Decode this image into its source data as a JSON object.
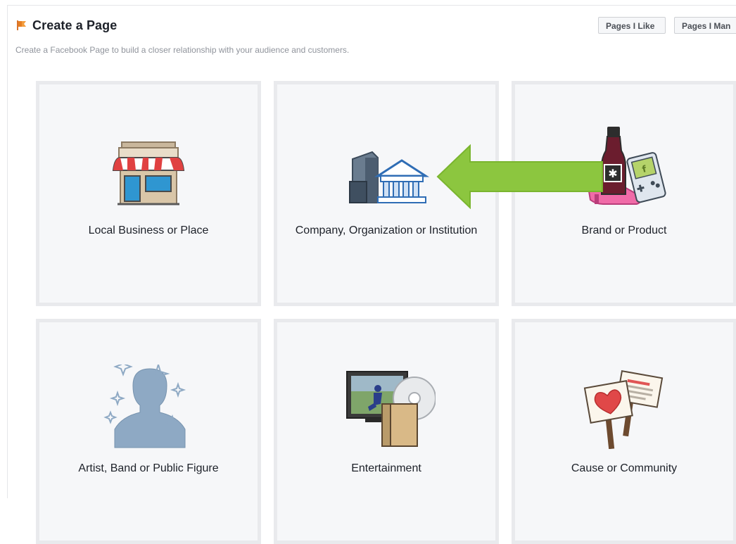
{
  "header": {
    "title": "Create a Page",
    "subtitle": "Create a Facebook Page to build a closer relationship with your audience and customers.",
    "buttons": {
      "pages_i_like": "Pages I Like",
      "pages_i_manage": "Pages I Man"
    },
    "icon": "flag-icon"
  },
  "categories": [
    {
      "label": "Local Business or Place",
      "icon": "storefront-icon"
    },
    {
      "label": "Company, Organization or Institution",
      "icon": "institution-building-icon"
    },
    {
      "label": "Brand or Product",
      "icon": "products-icon"
    },
    {
      "label": "Artist, Band or Public Figure",
      "icon": "person-silhouette-icon"
    },
    {
      "label": "Entertainment",
      "icon": "tv-dvd-icon"
    },
    {
      "label": "Cause or Community",
      "icon": "protest-signs-icon"
    }
  ],
  "annotation": {
    "icon": "green-arrow-icon",
    "color": "#8cc63f"
  },
  "colors": {
    "title": "#1d2129",
    "subtitle": "#90949c",
    "tile_background": "#f6f7f9",
    "tile_border": "#e9eaed"
  }
}
